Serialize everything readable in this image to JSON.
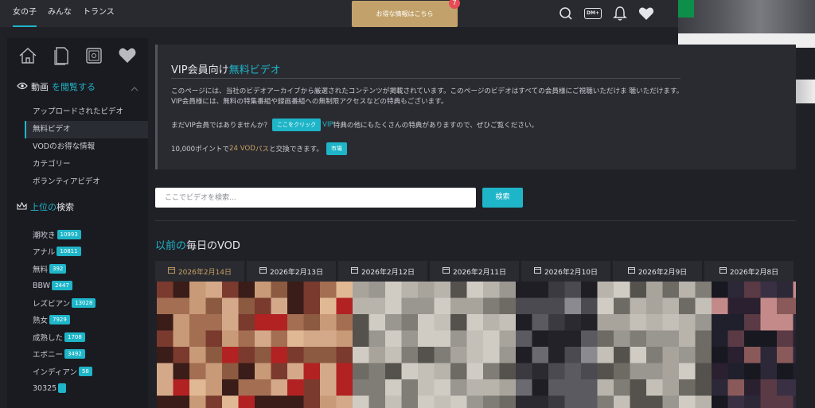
{
  "topnav": {
    "tabs": [
      {
        "label": "女の子",
        "active": true
      },
      {
        "label": "みんな",
        "active": false
      },
      {
        "label": "トランス",
        "active": false
      }
    ]
  },
  "promo": {
    "label": "お得な情報はこちら",
    "badge": "7"
  },
  "header_icons": {
    "dm_label": "DM+",
    "icons": [
      "search-icon",
      "dm-icon",
      "bell-icon",
      "heart-icon"
    ]
  },
  "sidebar": {
    "icons": [
      "home-icon",
      "document-icon",
      "safe-icon",
      "heart-icon"
    ],
    "videos_section": {
      "prefix": "動画",
      "accent": "を閲覧する"
    },
    "menu": [
      {
        "label": "アップロードされたビデオ",
        "active": false
      },
      {
        "label": "無料ビデオ",
        "active": true
      },
      {
        "label": "VODのお得な情報",
        "active": false
      },
      {
        "label": "カテゴリー",
        "active": false
      },
      {
        "label": "ボランティアビデオ",
        "active": false
      }
    ],
    "search_section": {
      "accent": "上位の",
      "suffix": "検索"
    },
    "tags": [
      {
        "label": "潮吹き",
        "count": "10993"
      },
      {
        "label": "アナル",
        "count": "10811"
      },
      {
        "label": "無料",
        "count": "392"
      },
      {
        "label": "BBW",
        "count": "2447"
      },
      {
        "label": "レズビアン",
        "count": "13028"
      },
      {
        "label": "熟女",
        "count": "7929"
      },
      {
        "label": "成熟した",
        "count": "1708"
      },
      {
        "label": "エボニー",
        "count": "3492"
      },
      {
        "label": "インディアン",
        "count": "58"
      },
      {
        "label": "30325",
        "count": ""
      }
    ]
  },
  "info": {
    "title_prefix": "VIP会員向け",
    "title_accent": "無料ビデオ",
    "body": "このページには、当社のビデオアーカイブから厳選されたコンテンツが掲載されています。このページのビデオはすべての会員様にご視聴いただけま 聴いただけます。VIP会員様には、無料の特集番組や録画番組への無制限アクセスなどの特典もございます。",
    "cta_text": "まだVIP会員ではありませんか？",
    "cta_button": "ここをクリック",
    "cta_link": "VIP",
    "cta_rest": "特典の他にもたくさんの特典がありますので、ぜひご覧ください。",
    "points_prefix": "10,000ポイントで",
    "points_highlight": "24 VOD",
    "points_link": "パス",
    "points_suffix": "と交換できます。",
    "points_button": "市場"
  },
  "search": {
    "placeholder": "ここでビデオを検索...",
    "button": "検索"
  },
  "daily": {
    "title_accent": "以前の",
    "title_rest": "毎日のVOD",
    "dates": [
      {
        "label": "2026年2月14日",
        "active": true
      },
      {
        "label": "2026年2月13日",
        "active": false
      },
      {
        "label": "2026年2月12日",
        "active": false
      },
      {
        "label": "2026年2月11日",
        "active": false
      },
      {
        "label": "2026年2月10日",
        "active": false
      },
      {
        "label": "2026年2月9日",
        "active": false
      },
      {
        "label": "2026年2月8日",
        "active": false
      }
    ]
  },
  "colors": {
    "accent": "#1fb5c8",
    "gold": "#c8a060",
    "background": "#202127",
    "panel": "#2a2b31",
    "sidebar": "#1a1b21"
  }
}
